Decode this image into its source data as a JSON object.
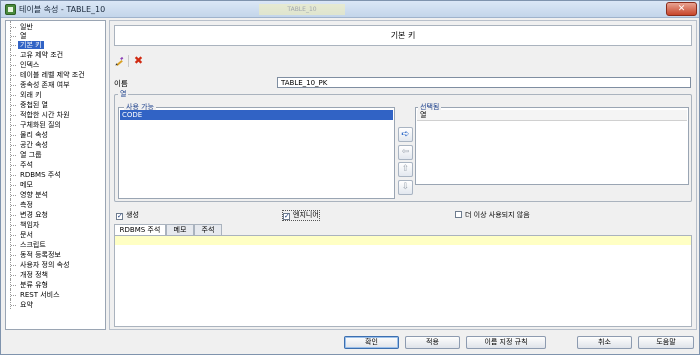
{
  "window": {
    "title": "테이블 속성 - TABLE_10",
    "background_tab": "TABLE_10",
    "close_symbol": "✕"
  },
  "nav": {
    "items": [
      {
        "label": "일반",
        "selected": false
      },
      {
        "label": "열",
        "selected": false
      },
      {
        "label": "기본 키",
        "selected": true
      },
      {
        "label": "고유 제약 조건",
        "selected": false
      },
      {
        "label": "인덱스",
        "selected": false
      },
      {
        "label": "테이블 레벨 제약 조건",
        "selected": false
      },
      {
        "label": "종속성 존재 여부",
        "selected": false
      },
      {
        "label": "외래 키",
        "selected": false
      },
      {
        "label": "중첩된 열",
        "selected": false
      },
      {
        "label": "적합한 시간 차원",
        "selected": false
      },
      {
        "label": "구체화된 질의",
        "selected": false
      },
      {
        "label": "물리 속성",
        "selected": false
      },
      {
        "label": "공간 속성",
        "selected": false
      },
      {
        "label": "열 그룹",
        "selected": false
      },
      {
        "label": "주석",
        "selected": false
      },
      {
        "label": "RDBMS 주석",
        "selected": false
      },
      {
        "label": "메모",
        "selected": false
      },
      {
        "label": "영향 분석",
        "selected": false
      },
      {
        "label": "측정",
        "selected": false
      },
      {
        "label": "변경 요청",
        "selected": false
      },
      {
        "label": "책임자",
        "selected": false
      },
      {
        "label": "문서",
        "selected": false
      },
      {
        "label": "스크립트",
        "selected": false
      },
      {
        "label": "동적 등록정보",
        "selected": false
      },
      {
        "label": "사용자 정의 속성",
        "selected": false
      },
      {
        "label": "개정 정책",
        "selected": false
      },
      {
        "label": "분류 유형",
        "selected": false
      },
      {
        "label": "REST 서비스",
        "selected": false
      },
      {
        "label": "요약",
        "selected": false
      }
    ]
  },
  "main": {
    "header": "기본 키",
    "toolbar": {
      "edit_icon": "edit-pencil-icon",
      "delete_icon": "delete-x-icon",
      "delete_symbol": "✖"
    },
    "name_label": "이름",
    "name_value": "TABLE_10_PK",
    "columns": {
      "group_label": "열",
      "available_label": "사용 가능",
      "available_items": [
        "CODE"
      ],
      "selected_label": "선택됨",
      "selected_header": "열",
      "buttons": {
        "add": "➪",
        "remove": "⇦",
        "up": "⇧",
        "down": "⇩"
      }
    },
    "checkboxes": {
      "generate": {
        "label": "생성",
        "checked": true,
        "mark": "✓"
      },
      "engineer": {
        "label": "엔지니어",
        "checked": true,
        "mark": "✓"
      },
      "deprecated": {
        "label": "더 이상 사용되지 않음",
        "checked": false,
        "mark": ""
      }
    },
    "tabs": [
      {
        "label": "RDBMS 주석",
        "active": true
      },
      {
        "label": "메모",
        "active": false
      },
      {
        "label": "주석",
        "active": false
      }
    ]
  },
  "footer": {
    "ok": "확인",
    "apply": "적용",
    "naming_rules": "이름 지정 규칙",
    "cancel": "취소",
    "help": "도움말"
  },
  "colors": {
    "selection": "#3163c5",
    "close_button": "#c7452a",
    "note_highlight": "#ffffc4",
    "delete_icon": "#d02a12"
  }
}
